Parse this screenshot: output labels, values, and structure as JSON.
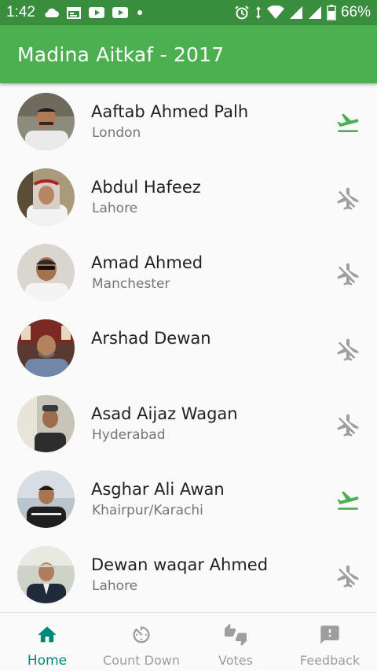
{
  "status_bar": {
    "time": "1:42",
    "battery": "66%",
    "left_icons": [
      "cloud-icon",
      "calendar-icon",
      "youtube-icon",
      "youtube-icon",
      "dot-icon"
    ],
    "right_icons": [
      "alarm-icon",
      "data-arrows-icon",
      "wifi-icon",
      "signal-icon",
      "signal-icon",
      "battery-icon"
    ]
  },
  "app_bar": {
    "title": "Madina Aitkaf - 2017"
  },
  "colors": {
    "primary": "#4caf50",
    "primary_dark": "#388e3c",
    "accent": "#00897b",
    "flight_active": "#4caf50",
    "flight_inactive": "#9e9e9e"
  },
  "people": [
    {
      "name": "Aaftab Ahmed Palh",
      "city": "London",
      "flight_status": "departed",
      "flight_icon": "flight-takeoff-icon"
    },
    {
      "name": "Abdul Hafeez",
      "city": "Lahore",
      "flight_status": "off",
      "flight_icon": "airplanemode-off-icon"
    },
    {
      "name": "Amad Ahmed",
      "city": "Manchester",
      "flight_status": "off",
      "flight_icon": "airplanemode-off-icon"
    },
    {
      "name": "Arshad Dewan",
      "city": "",
      "flight_status": "off",
      "flight_icon": "airplanemode-off-icon"
    },
    {
      "name": "Asad Aijaz Wagan",
      "city": "Hyderabad",
      "flight_status": "off",
      "flight_icon": "airplanemode-off-icon"
    },
    {
      "name": "Asghar Ali Awan",
      "city": "Khairpur/Karachi",
      "flight_status": "departed",
      "flight_icon": "flight-takeoff-icon"
    },
    {
      "name": "Dewan waqar Ahmed",
      "city": "Lahore",
      "flight_status": "off",
      "flight_icon": "airplanemode-off-icon"
    }
  ],
  "bottom_nav": [
    {
      "label": "Home",
      "icon": "home-icon",
      "active": true
    },
    {
      "label": "Count Down",
      "icon": "timer-icon",
      "active": false
    },
    {
      "label": "Votes",
      "icon": "thumbs-up-down-icon",
      "active": false
    },
    {
      "label": "Feedback",
      "icon": "feedback-icon",
      "active": false
    }
  ]
}
